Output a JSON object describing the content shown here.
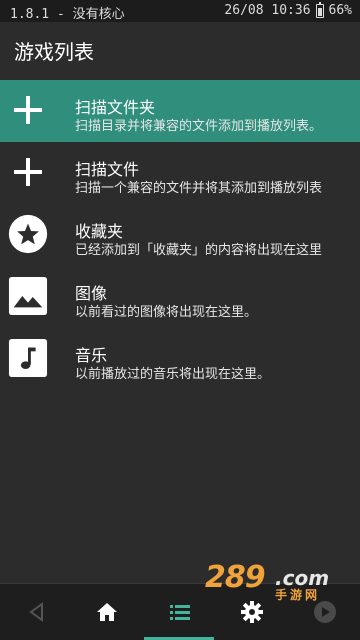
{
  "status": {
    "left": "1.8.1 - 没有核心",
    "time": "26/08 10:36",
    "battery": "66%",
    "battery_level": 0.66
  },
  "header": {
    "title": "游戏列表"
  },
  "items": [
    {
      "label": "扫描文件夹",
      "sub": "扫描目录并将兼容的文件添加到播放列表。",
      "icon": "plus-icon",
      "selected": true
    },
    {
      "label": "扫描文件",
      "sub": "扫描一个兼容的文件并将其添加到播放列表",
      "icon": "plus-icon",
      "selected": false
    },
    {
      "label": "收藏夹",
      "sub": "已经添加到「收藏夹」的内容将出现在这里",
      "icon": "star-icon",
      "selected": false
    },
    {
      "label": "图像",
      "sub": "以前看过的图像将出现在这里。",
      "icon": "image-icon",
      "selected": false
    },
    {
      "label": "音乐",
      "sub": "以前播放过的音乐将出现在这里。",
      "icon": "music-note-icon",
      "selected": false
    }
  ],
  "bottom_nav": {
    "buttons": [
      "back-icon",
      "home-icon",
      "list-icon",
      "settings-icon",
      "play-icon"
    ],
    "active": "list-icon"
  },
  "watermark": {
    "number": "289",
    "domain": ".com",
    "cn": "手游网"
  },
  "colors": {
    "accent": "#2f8f7c",
    "indicator": "#44b59b",
    "background": "#2c2c2c"
  }
}
